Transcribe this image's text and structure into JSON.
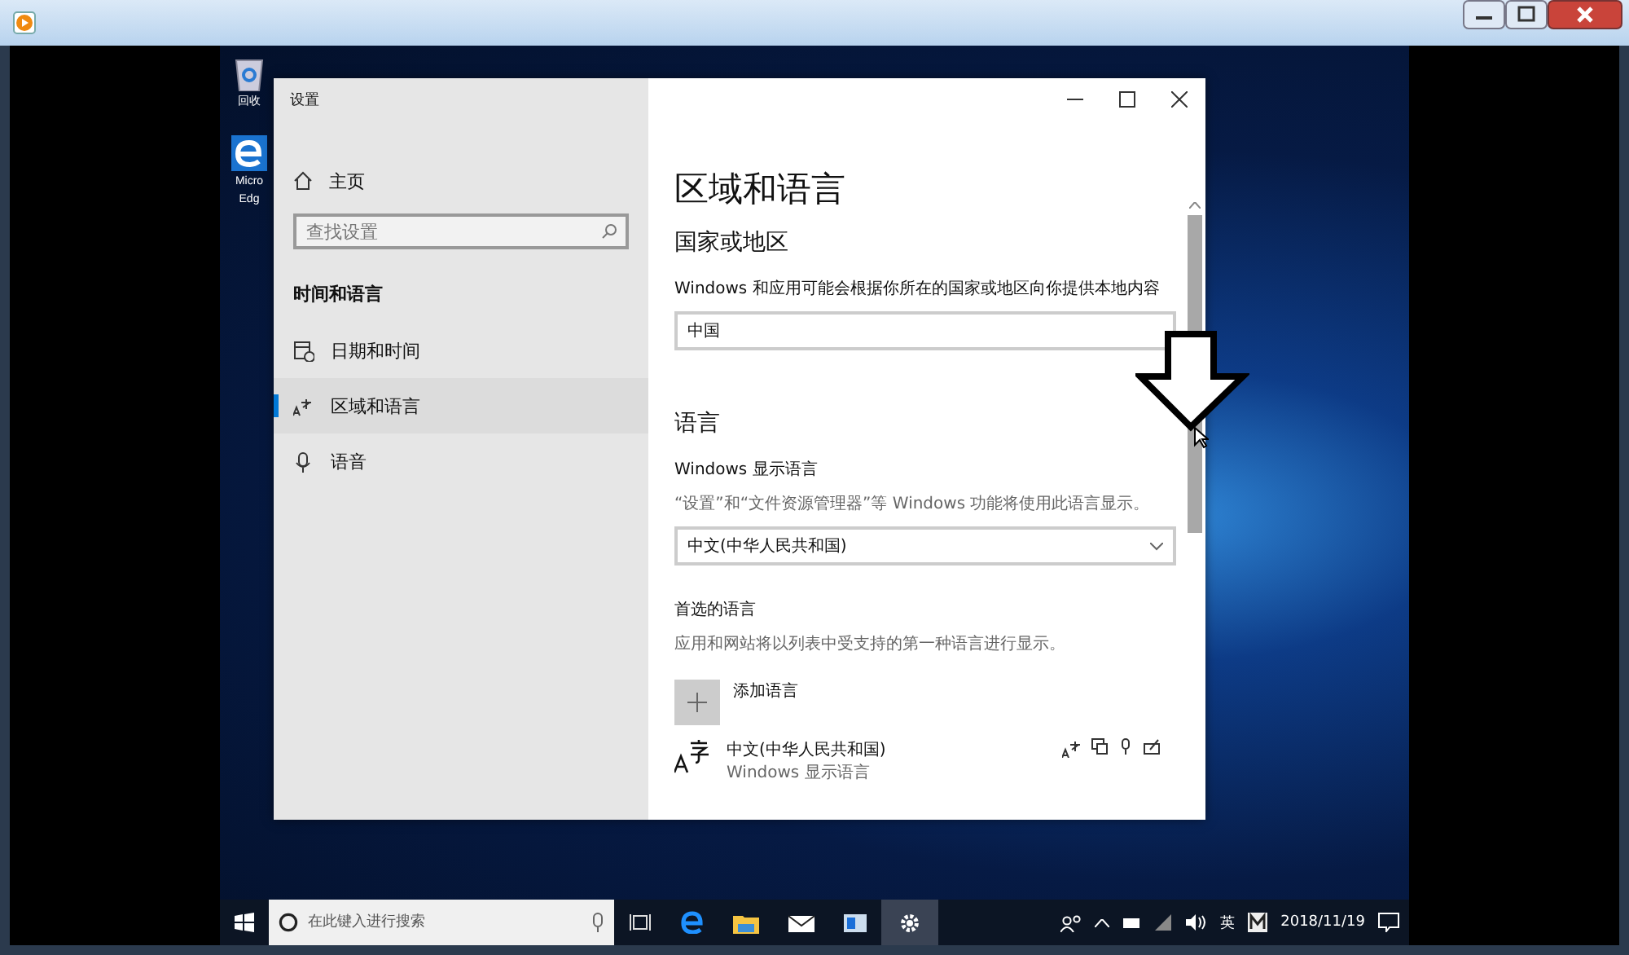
{
  "desktop_icons": [
    {
      "lines": [
        "回收"
      ]
    },
    {
      "lines": [
        "Micro",
        "Edg"
      ]
    }
  ],
  "settings": {
    "title": "设置",
    "sidebar": {
      "home": "主页",
      "search": {
        "placeholder": "查找设置"
      },
      "section": "时间和语言",
      "items": [
        {
          "label": "日期和时间",
          "selected": false
        },
        {
          "label": "区域和语言",
          "selected": true
        },
        {
          "label": "语音",
          "selected": false
        }
      ]
    },
    "page_title": "区域和语言",
    "country": {
      "heading": "国家或地区",
      "description": "Windows 和应用可能会根据你所在的国家或地区向你提供本地内容",
      "value": "中国"
    },
    "language": {
      "heading": "语言",
      "display_label": "Windows 显示语言",
      "display_description": "“设置”和“文件资源管理器”等 Windows 功能将使用此语言显示。",
      "display_value": "中文(中华人民共和国)",
      "preferred_heading": "首选的语言",
      "preferred_description": "应用和网站将以列表中受支持的第一种语言进行显示。",
      "add_label": "添加语言",
      "items": [
        {
          "name": "中文(中华人民共和国)",
          "subtitle": "Windows 显示语言"
        }
      ]
    }
  },
  "taskbar": {
    "search": {
      "placeholder": "在此键入进行搜索"
    },
    "ime": "英",
    "date": "2018/11/19"
  }
}
